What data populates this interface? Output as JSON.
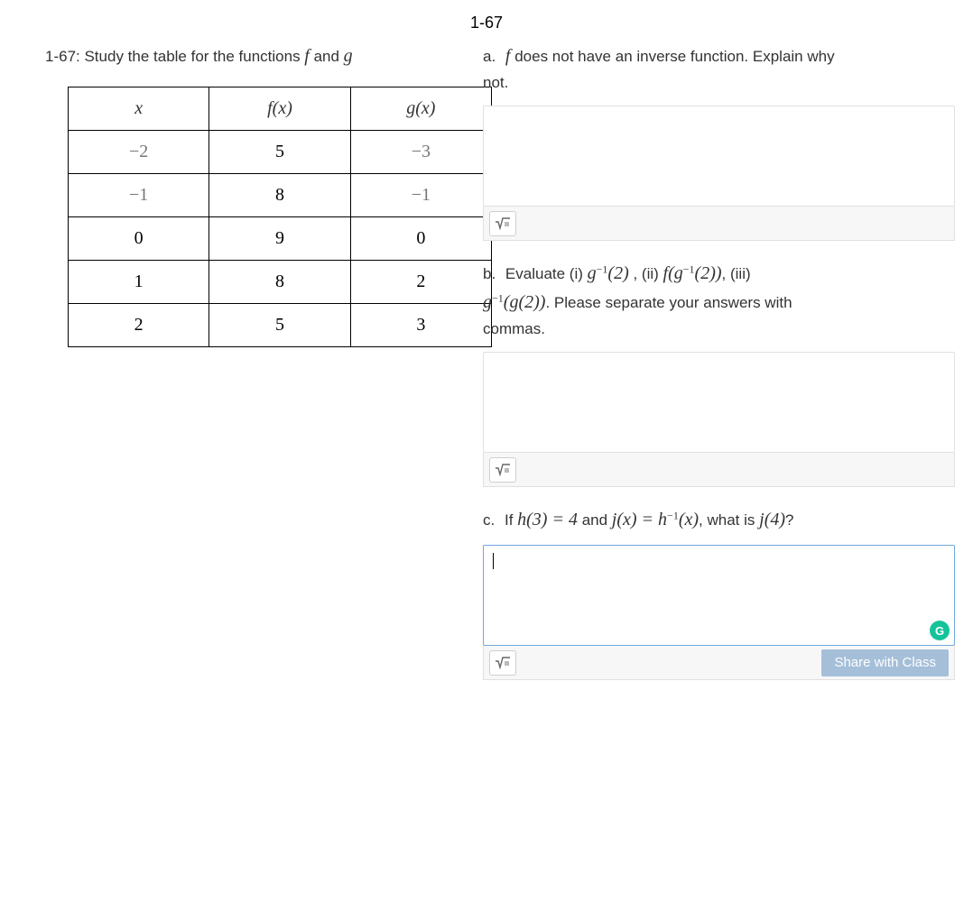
{
  "title": "1-67",
  "intro": {
    "prefix": "1-67:  Study the table for the functions ",
    "f": "f",
    "mid": " and ",
    "g": "g"
  },
  "table": {
    "headers": {
      "x": "x",
      "fx": "f(x)",
      "gx": "g(x)"
    },
    "rows": [
      {
        "x": "−2",
        "f": "5",
        "g": "−3",
        "xneg": true,
        "gneg": true
      },
      {
        "x": "−1",
        "f": "8",
        "g": "−1",
        "xneg": true,
        "gneg": true
      },
      {
        "x": "0",
        "f": "9",
        "g": "0"
      },
      {
        "x": "1",
        "f": "8",
        "g": "2"
      },
      {
        "x": "2",
        "f": "5",
        "g": "3"
      }
    ]
  },
  "qa": {
    "lbl": "a.",
    "line1_1": "f",
    "line1_2": " does not have an inverse function.  Explain why",
    "line2": "not."
  },
  "qb": {
    "lbl": "b.",
    "pre": "Evaluate (i) ",
    "p1a": "g",
    "p1b": "−1",
    "p1c": "(2)",
    "mid1": " ,  (ii) ",
    "p2a": "f",
    "p2b": "g",
    "p2c": "−1",
    "p2d": "(2)",
    "mid2": ",  (iii)",
    "p3a": "g",
    "p3b": "−1",
    "p3c": "g",
    "p3d": "(2)",
    "tail": ".  Please separate your answers with",
    "tail2": "commas."
  },
  "qc": {
    "lbl": "c.",
    "t1": "If ",
    "h": "h",
    "t2": "(3) = 4",
    "t3": " and ",
    "j": "j",
    "t4": "(x) = ",
    "h2": "h",
    "t5": "−1",
    "t6": "(x)",
    "t7": ", what is ",
    "j2": "j",
    "t8": "(4)",
    "t9": "?"
  },
  "buttons": {
    "share": "Share with Class",
    "grammarly": "G"
  },
  "answers": {
    "a": "",
    "b": "",
    "c": ""
  }
}
